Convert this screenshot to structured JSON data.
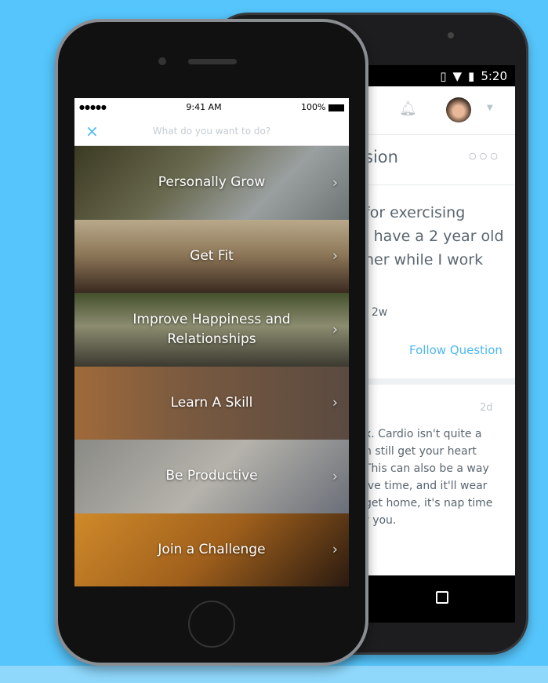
{
  "android": {
    "time": "5:20",
    "status_icons": [
      "vibrate-icon",
      "wifi-icon",
      "signal-icon",
      "battery-charging-icon"
    ],
    "title_fragment": "sion",
    "question_lines": [
      "for exercising",
      "I have a 2 year old",
      "her while I work"
    ],
    "meta": "· 2w",
    "follow_label": "Follow Question",
    "answer_age": "2d",
    "answer_lines": [
      "x. Cardio isn't quite a",
      "n still get your heart",
      "This can also be a way",
      "ive time, and it'll wear",
      "get home, it's nap time",
      "r you."
    ]
  },
  "iphone": {
    "carrier": "●●●●●",
    "time": "9:41 AM",
    "battery": "100%",
    "header_title": "What do you want to do?",
    "close_icon": "×",
    "tiles": [
      {
        "label": "Personally Grow"
      },
      {
        "label": "Get Fit"
      },
      {
        "label": "Improve Happiness and Relationships"
      },
      {
        "label": "Learn A Skill"
      },
      {
        "label": "Be Productive"
      },
      {
        "label": "Join a Challenge"
      }
    ]
  },
  "colors": {
    "background": "#55c5fb",
    "accent": "#4db8f0"
  }
}
